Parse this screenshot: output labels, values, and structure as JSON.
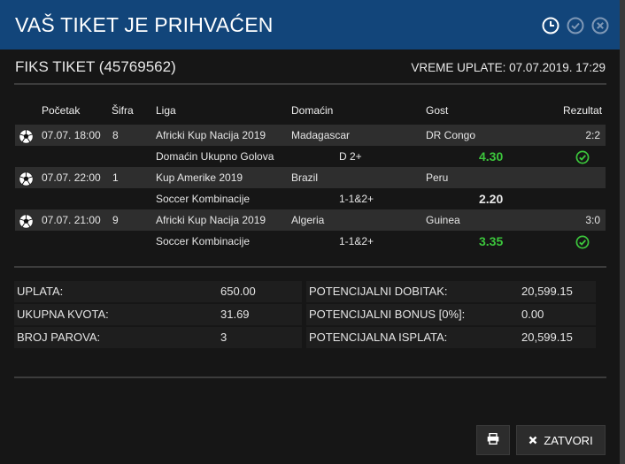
{
  "header": {
    "title": "VAŠ TIKET JE PRIHVAĆEN",
    "icons": [
      "clock-icon",
      "check-circle-icon",
      "close-circle-icon"
    ]
  },
  "ticket": {
    "label": "FIKS TIKET (45769562)",
    "time": "VREME UPLATE: 07.07.2019. 17:29"
  },
  "columns": {
    "start": "Početak",
    "code": "Šifra",
    "league": "Liga",
    "home": "Domaćin",
    "away": "Gost",
    "result": "Rezultat"
  },
  "matches": [
    {
      "start": "07.07. 18:00",
      "code": "8",
      "league": "Africki Kup Nacija 2019",
      "home": "Madagascar",
      "away": "DR Congo",
      "result": "2:2",
      "bet_type": "Domaćin Ukupno Golova",
      "pick": "D 2+",
      "odd": "4.30",
      "won": true
    },
    {
      "start": "07.07. 22:00",
      "code": "1",
      "league": "Kup Amerike 2019",
      "home": "Brazil",
      "away": "Peru",
      "result": "",
      "bet_type": "Soccer Kombinacije",
      "pick": "1-1&2+",
      "odd": "2.20",
      "won": false
    },
    {
      "start": "07.07. 21:00",
      "code": "9",
      "league": "Africki Kup Nacija 2019",
      "home": "Algeria",
      "away": "Guinea",
      "result": "3:0",
      "bet_type": "Soccer Kombinacije",
      "pick": "1-1&2+",
      "odd": "3.35",
      "won": true
    }
  ],
  "summary": {
    "left": [
      {
        "label": "UPLATA:",
        "value": "650.00"
      },
      {
        "label": "UKUPNA KVOTA:",
        "value": "31.69"
      },
      {
        "label": "BROJ PAROVA:",
        "value": "3"
      }
    ],
    "right": [
      {
        "label": "POTENCIJALNI DOBITAK:",
        "value": "20,599.15"
      },
      {
        "label": "POTENCIJALNI BONUS [0%]:",
        "value": "0.00"
      },
      {
        "label": "POTENCIJALNA ISPLATA:",
        "value": "20,599.15"
      }
    ]
  },
  "buttons": {
    "close_label": "ZATVORI",
    "print_icon": "printer-icon",
    "close_icon": "x-icon"
  },
  "colors": {
    "header_bg": "#12457a",
    "win_green": "#3cc63c",
    "match_row_bg": "#2e2e2e"
  }
}
